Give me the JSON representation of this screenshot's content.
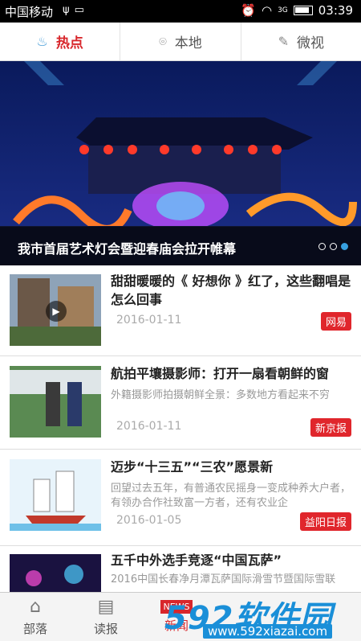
{
  "status": {
    "carrier": "中国移动",
    "usb": "ψ",
    "time": "03:39",
    "net": "3G"
  },
  "tabs": [
    {
      "label": "热点",
      "icon": "flame-icon",
      "glyph": "♨"
    },
    {
      "label": "本地",
      "icon": "location-pin-icon",
      "glyph": "⌾"
    },
    {
      "label": "微视",
      "icon": "microphone-icon",
      "glyph": "✎"
    }
  ],
  "banner": {
    "caption": "我市首届艺术灯会暨迎春庙会拉开帷幕",
    "slide_count": 3,
    "active_slide": 3
  },
  "news": [
    {
      "title": "甜甜暖暖的《 好想你 》红了，这些翻唱是怎么回事",
      "summary": "",
      "date": "2016-01-11",
      "source": "网易",
      "has_video": true
    },
    {
      "title": "航拍平壤摄影师：打开一扇看朝鲜的窗",
      "summary": "外籍摄影师拍摄朝鲜全景：多数地方看起来不穷",
      "date": "2016-01-11",
      "source": "新京报",
      "has_video": false
    },
    {
      "title": "迈步“十三五”“三农”愿景新",
      "summary": "回望过去五年，有普通农民摇身一变成种养大户者，有领办合作社致富一方者，还有农业企",
      "date": "2016-01-05",
      "source": "益阳日报",
      "has_video": false
    },
    {
      "title": "五千中外选手竞逐“中国瓦萨”",
      "summary": "2016中国长春净月潭瓦萨国际滑雪节暨国际雪联",
      "date": "",
      "source": "",
      "has_video": false
    }
  ],
  "bottom_nav": [
    {
      "label": "部落",
      "icon": "home-icon",
      "glyph": "⌂"
    },
    {
      "label": "读报",
      "icon": "newspaper-icon",
      "glyph": "▤"
    },
    {
      "label": "新闻",
      "icon": "news-icon",
      "glyph": "NEWS"
    }
  ],
  "watermark": {
    "brand": "592软件园",
    "url": "www.592xiazai.com"
  },
  "colors": {
    "accent": "#d8262b",
    "banner_dot": "#37a0e0"
  }
}
